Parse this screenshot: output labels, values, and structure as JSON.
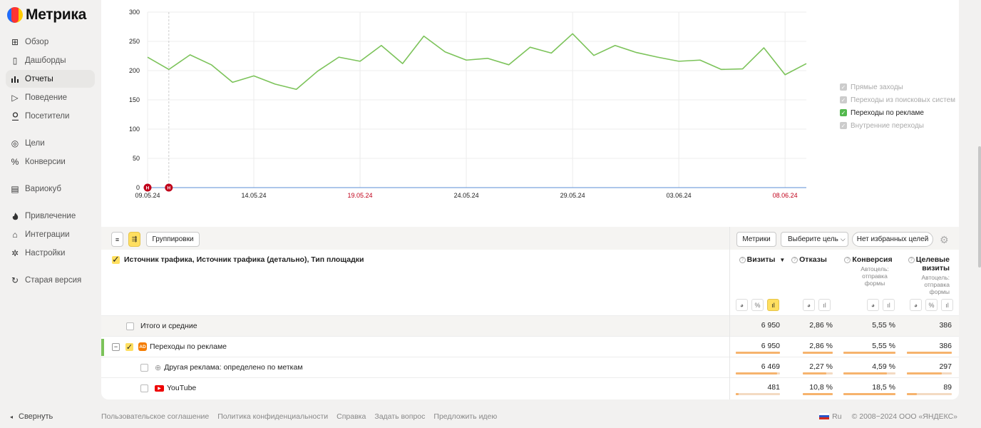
{
  "app": {
    "title": "Метрика"
  },
  "sidebar": {
    "items": [
      {
        "label": "Обзор",
        "icon": "grid-icon"
      },
      {
        "label": "Дашборды",
        "icon": "dashboard-icon"
      },
      {
        "label": "Отчеты",
        "icon": "bar-chart-icon",
        "active": true
      },
      {
        "label": "Поведение",
        "icon": "play-icon"
      },
      {
        "label": "Посетители",
        "icon": "person-icon"
      },
      {
        "label": "Цели",
        "icon": "target-icon"
      },
      {
        "label": "Конверсии",
        "icon": "percent-icon"
      },
      {
        "label": "Вариокуб",
        "icon": "cube-icon"
      },
      {
        "label": "Привлечение",
        "icon": "flame-icon"
      },
      {
        "label": "Интеграции",
        "icon": "puzzle-icon"
      },
      {
        "label": "Настройки",
        "icon": "gear-icon"
      },
      {
        "label": "Старая версия",
        "icon": "history-icon"
      }
    ],
    "collapse_label": "Свернуть"
  },
  "chart_data": {
    "type": "line",
    "x": [
      "09.05.24",
      "10.05.24",
      "11.05.24",
      "12.05.24",
      "13.05.24",
      "14.05.24",
      "15.05.24",
      "16.05.24",
      "17.05.24",
      "18.05.24",
      "19.05.24",
      "20.05.24",
      "21.05.24",
      "22.05.24",
      "23.05.24",
      "24.05.24",
      "25.05.24",
      "26.05.24",
      "27.05.24",
      "28.05.24",
      "29.05.24",
      "30.05.24",
      "31.05.24",
      "01.06.24",
      "02.06.24",
      "03.06.24",
      "04.06.24",
      "05.06.24",
      "06.06.24",
      "07.06.24",
      "08.06.24",
      "09.06.24"
    ],
    "series": [
      {
        "name": "Переходы по рекламе",
        "color": "#7cc35a",
        "values": [
          223,
          202,
          227,
          210,
          180,
          191,
          177,
          168,
          199,
          223,
          216,
          243,
          212,
          259,
          232,
          218,
          221,
          210,
          240,
          230,
          263,
          226,
          243,
          231,
          223,
          216,
          218,
          202,
          203,
          239,
          193,
          212
        ]
      }
    ],
    "ylim": [
      0,
      300
    ],
    "yticks": [
      0,
      50,
      100,
      150,
      200,
      250,
      300
    ],
    "xtick_labels": [
      {
        "label": "09.05.24",
        "index": 0,
        "color": "#222"
      },
      {
        "label": "14.05.24",
        "index": 5,
        "color": "#222"
      },
      {
        "label": "19.05.24",
        "index": 10,
        "color": "#c0001a"
      },
      {
        "label": "24.05.24",
        "index": 15,
        "color": "#222"
      },
      {
        "label": "29.05.24",
        "index": 20,
        "color": "#222"
      },
      {
        "label": "03.06.24",
        "index": 25,
        "color": "#222"
      },
      {
        "label": "08.06.24",
        "index": 30,
        "color": "#c0001a"
      }
    ],
    "markers": [
      {
        "label": "Н",
        "index": 0
      },
      {
        "label": "Н",
        "index": 1
      }
    ],
    "grid": true
  },
  "legend": [
    {
      "label": "Прямые заходы",
      "on": false
    },
    {
      "label": "Переходы из поисковых систем",
      "on": false
    },
    {
      "label": "Переходы по рекламе",
      "on": true
    },
    {
      "label": "Внутренние переходы",
      "on": false
    }
  ],
  "toolbar": {
    "groupings_label": "Группировки",
    "metrics_label": "Метрики",
    "goal_select_label": "Выберите цель",
    "favorites_label": "Нет избранных целей"
  },
  "table": {
    "dimension_header": "Источник трафика, Источник трафика (детально), Тип площадки",
    "columns": [
      {
        "title": "Визиты",
        "sort": "▼",
        "sub": ""
      },
      {
        "title": "Отказы",
        "sort": "",
        "sub": ""
      },
      {
        "title": "Конверсия",
        "sort": "",
        "sub": "Автоцель: отправка формы"
      },
      {
        "title": "Целевые визиты",
        "sort": "",
        "sub": "Автоцель: отправка формы"
      }
    ],
    "rows": [
      {
        "label": "Итого и средние",
        "values": [
          "6 950",
          "2,86 %",
          "5,55 %",
          "386"
        ],
        "fills": [],
        "total": true
      },
      {
        "label": "Переходы по рекламе",
        "values": [
          "6 950",
          "2,86 %",
          "5,55 %",
          "386"
        ],
        "fills": [
          1,
          1,
          1,
          1
        ],
        "badge": "AD"
      },
      {
        "label": "Другая реклама: определено по меткам",
        "values": [
          "6 469",
          "2,27 %",
          "4,59 %",
          "297"
        ],
        "fills": [
          0.93,
          0.79,
          0.83,
          0.77
        ]
      },
      {
        "label": "YouTube",
        "values": [
          "481",
          "10,8 %",
          "18,5 %",
          "89"
        ],
        "fills": [
          0.07,
          1,
          1,
          0.23
        ]
      }
    ]
  },
  "footer": {
    "links": [
      "Пользовательское соглашение",
      "Политика конфиденциальности",
      "Справка",
      "Задать вопрос",
      "Предложить идею"
    ],
    "lang": "Ru",
    "copyright": "© 2008−2024 ООО «ЯНДЕКС»"
  }
}
